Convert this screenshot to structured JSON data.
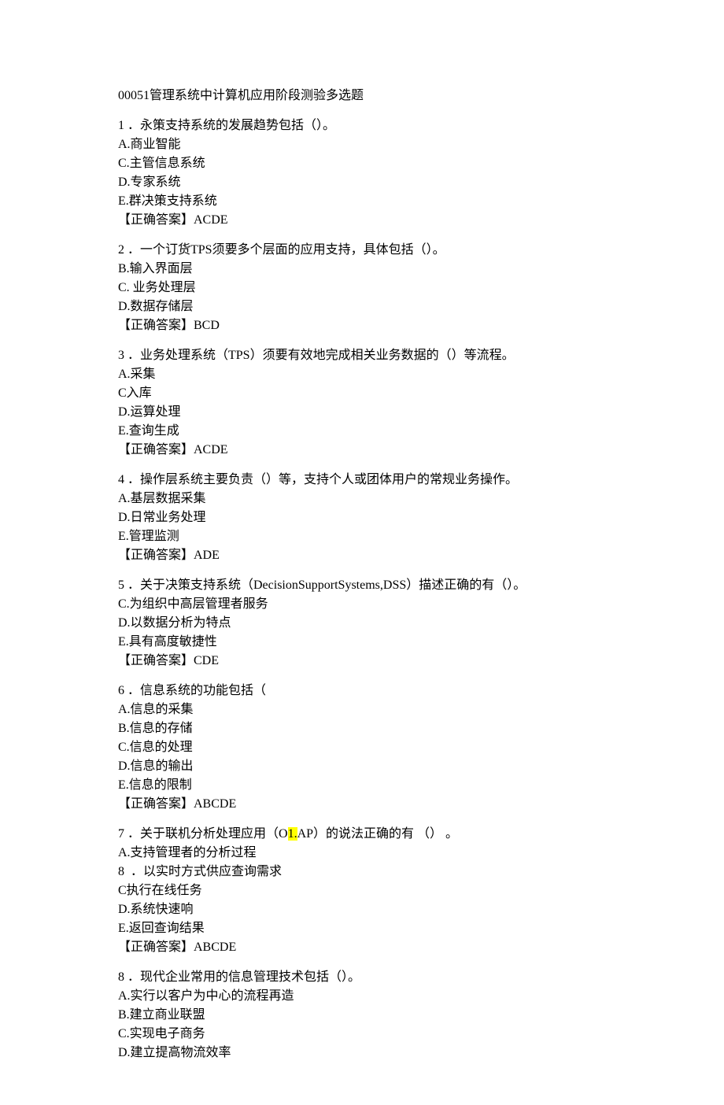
{
  "title": "00051管理系统中计算机应用阶段测验多选题",
  "questions": [
    {
      "num": "1",
      "stem": " ．永策支持系统的发展趋势包括（）。",
      "options": [
        "A.商业智能",
        "C.主管信息系统",
        "D.专家系统",
        "E.群决策支持系统"
      ],
      "answer": "【正确答案】ACDE"
    },
    {
      "num": "2",
      "stem": " ．一个订货TPS须要多个层面的应用支持，具体包括（）。",
      "options": [
        "B.输入界面层",
        "C. 业务处理层",
        "D.数据存储层"
      ],
      "answer": "【正确答案】BCD"
    },
    {
      "num": "3",
      "stem": " ．业务处理系统（TPS）须要有效地完成相关业务数据的（）等流程。",
      "options": [
        "A.采集",
        "C入库",
        "D.运算处理",
        "E.查询生成"
      ],
      "answer": "【正确答案】ACDE"
    },
    {
      "num": "4",
      "stem": " ．操作层系统主要负责（）等，支持个人或团体用户的常规业务操作。",
      "options": [
        "A.基层数据采集",
        "D.日常业务处理",
        "E.管理监测"
      ],
      "answer": "【正确答案】ADE"
    },
    {
      "num": "5",
      "stem": " ．关于决策支持系统（DecisionSupportSystems,DSS）描述正确的有（）。",
      "options": [
        "C.为组织中高层管理者服务",
        "D.以数据分析为特点",
        "E.具有高度敏捷性"
      ],
      "answer": "【正确答案】CDE"
    },
    {
      "num": "6",
      "stem": " ．信息系统的功能包括（",
      "options": [
        "A.信息的采集",
        "B.信息的存储",
        "C.信息的处理",
        "D.信息的输出",
        "E.信息的限制"
      ],
      "answer": "【正确答案】ABCDE"
    },
    {
      "num": "7",
      "stem_pre": " ．关于联机分析处理应用（O",
      "stem_hl": "1.",
      "stem_post": "AP）的说法正确的有 （） 。",
      "options": [
        "A.支持管理者的分析过程",
        "8  ．以实时方式供应查询需求",
        "C执行在线任务",
        "D.系统快速响",
        "E.返回查询结果"
      ],
      "answer": "【正确答案】ABCDE"
    },
    {
      "num": "8",
      "stem": " ．现代企业常用的信息管理技术包括（）。",
      "options": [
        "A.实行以客户为中心的流程再造",
        "B.建立商业联盟",
        "C.实现电子商务",
        "D.建立提高物流效率"
      ],
      "answer": ""
    }
  ]
}
